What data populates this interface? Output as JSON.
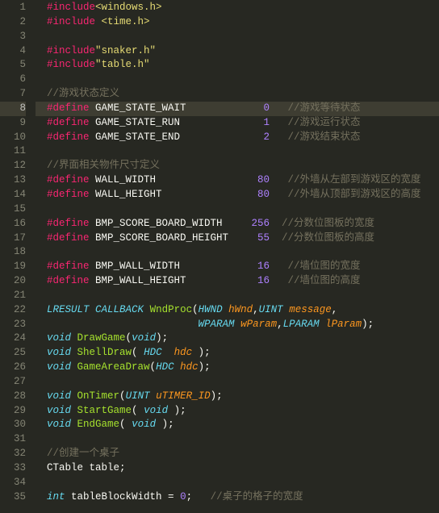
{
  "gutter": {
    "start": 1,
    "end": 35,
    "active": 8
  },
  "code": {
    "lines": [
      [
        {
          "c": "tok-preproc",
          "t": "#include"
        },
        {
          "c": "tok-string",
          "t": "<windows.h>"
        }
      ],
      [
        {
          "c": "tok-preproc",
          "t": "#include"
        },
        {
          "c": "tok-plain",
          "t": " "
        },
        {
          "c": "tok-string",
          "t": "<time.h>"
        }
      ],
      [],
      [
        {
          "c": "tok-preproc",
          "t": "#include"
        },
        {
          "c": "tok-string",
          "t": "\"snaker.h\""
        }
      ],
      [
        {
          "c": "tok-preproc",
          "t": "#include"
        },
        {
          "c": "tok-string",
          "t": "\"table.h\""
        }
      ],
      [],
      [
        {
          "c": "tok-comment",
          "t": "//游戏状态定义"
        }
      ],
      [
        {
          "c": "tok-preproc",
          "t": "#define"
        },
        {
          "c": "tok-plain",
          "t": " "
        },
        {
          "c": "tok-ident col1",
          "t": "GAME_STATE_WAIT"
        },
        {
          "c": "tok-number col2",
          "t": "0"
        },
        {
          "c": "tok-plain",
          "t": "   "
        },
        {
          "c": "tok-comment",
          "t": "//游戏等待状态"
        }
      ],
      [
        {
          "c": "tok-preproc",
          "t": "#define"
        },
        {
          "c": "tok-plain",
          "t": " "
        },
        {
          "c": "tok-ident col1",
          "t": "GAME_STATE_RUN"
        },
        {
          "c": "tok-number col2",
          "t": "1"
        },
        {
          "c": "tok-plain",
          "t": "   "
        },
        {
          "c": "tok-comment",
          "t": "//游戏运行状态"
        }
      ],
      [
        {
          "c": "tok-preproc",
          "t": "#define"
        },
        {
          "c": "tok-plain",
          "t": " "
        },
        {
          "c": "tok-ident col1",
          "t": "GAME_STATE_END"
        },
        {
          "c": "tok-number col2",
          "t": "2"
        },
        {
          "c": "tok-plain",
          "t": "   "
        },
        {
          "c": "tok-comment",
          "t": "//游戏结束状态"
        }
      ],
      [],
      [
        {
          "c": "tok-comment",
          "t": "//界面相关物件尺寸定义"
        }
      ],
      [
        {
          "c": "tok-preproc",
          "t": "#define"
        },
        {
          "c": "tok-plain",
          "t": " "
        },
        {
          "c": "tok-ident col1",
          "t": "WALL_WIDTH"
        },
        {
          "c": "tok-number col2",
          "t": "80"
        },
        {
          "c": "tok-plain",
          "t": "   "
        },
        {
          "c": "tok-comment",
          "t": "//外墙从左部到游戏区的宽度"
        }
      ],
      [
        {
          "c": "tok-preproc",
          "t": "#define"
        },
        {
          "c": "tok-plain",
          "t": " "
        },
        {
          "c": "tok-ident col1",
          "t": "WALL_HEIGHT"
        },
        {
          "c": "tok-number col2",
          "t": "80"
        },
        {
          "c": "tok-plain",
          "t": "   "
        },
        {
          "c": "tok-comment",
          "t": "//外墙从顶部到游戏区的高度"
        }
      ],
      [],
      [
        {
          "c": "tok-preproc",
          "t": "#define"
        },
        {
          "c": "tok-plain",
          "t": " "
        },
        {
          "c": "tok-ident col1",
          "t": "BMP_SCORE_BOARD_WIDTH"
        },
        {
          "c": "tok-number col2",
          "t": "256"
        },
        {
          "c": "tok-plain",
          "t": "  "
        },
        {
          "c": "tok-comment",
          "t": "//分数位图板的宽度"
        }
      ],
      [
        {
          "c": "tok-preproc",
          "t": "#define"
        },
        {
          "c": "tok-plain",
          "t": " "
        },
        {
          "c": "tok-ident col1",
          "t": "BMP_SCORE_BOARD_HEIGHT"
        },
        {
          "c": "tok-number col2",
          "t": "55"
        },
        {
          "c": "tok-plain",
          "t": "  "
        },
        {
          "c": "tok-comment",
          "t": "//分数位图板的高度"
        }
      ],
      [],
      [
        {
          "c": "tok-preproc",
          "t": "#define"
        },
        {
          "c": "tok-plain",
          "t": " "
        },
        {
          "c": "tok-ident col1",
          "t": "BMP_WALL_WIDTH"
        },
        {
          "c": "tok-number col2",
          "t": "16"
        },
        {
          "c": "tok-plain",
          "t": "   "
        },
        {
          "c": "tok-comment",
          "t": "//墙位图的宽度"
        }
      ],
      [
        {
          "c": "tok-preproc",
          "t": "#define"
        },
        {
          "c": "tok-plain",
          "t": " "
        },
        {
          "c": "tok-ident col1",
          "t": "BMP_WALL_HEIGHT"
        },
        {
          "c": "tok-number col2",
          "t": "16"
        },
        {
          "c": "tok-plain",
          "t": "   "
        },
        {
          "c": "tok-comment",
          "t": "//墙位图的高度"
        }
      ],
      [],
      [
        {
          "c": "tok-type",
          "t": "LRESULT"
        },
        {
          "c": "tok-plain",
          "t": " "
        },
        {
          "c": "tok-type",
          "t": "CALLBACK"
        },
        {
          "c": "tok-plain",
          "t": " "
        },
        {
          "c": "tok-func",
          "t": "WndProc"
        },
        {
          "c": "tok-plain",
          "t": "("
        },
        {
          "c": "tok-type",
          "t": "HWND"
        },
        {
          "c": "tok-plain",
          "t": " "
        },
        {
          "c": "tok-param",
          "t": "hWnd"
        },
        {
          "c": "tok-plain",
          "t": ","
        },
        {
          "c": "tok-type",
          "t": "UINT"
        },
        {
          "c": "tok-plain",
          "t": " "
        },
        {
          "c": "tok-param",
          "t": "message"
        },
        {
          "c": "tok-plain",
          "t": ","
        }
      ],
      [
        {
          "c": "tok-plain",
          "t": "                         "
        },
        {
          "c": "tok-type",
          "t": "WPARAM"
        },
        {
          "c": "tok-plain",
          "t": " "
        },
        {
          "c": "tok-param",
          "t": "wParam"
        },
        {
          "c": "tok-plain",
          "t": ","
        },
        {
          "c": "tok-type",
          "t": "LPARAM"
        },
        {
          "c": "tok-plain",
          "t": " "
        },
        {
          "c": "tok-param",
          "t": "lParam"
        },
        {
          "c": "tok-plain",
          "t": ");"
        }
      ],
      [
        {
          "c": "tok-type",
          "t": "void"
        },
        {
          "c": "tok-plain",
          "t": " "
        },
        {
          "c": "tok-func",
          "t": "DrawGame"
        },
        {
          "c": "tok-plain",
          "t": "("
        },
        {
          "c": "tok-type",
          "t": "void"
        },
        {
          "c": "tok-plain",
          "t": ");"
        }
      ],
      [
        {
          "c": "tok-type",
          "t": "void"
        },
        {
          "c": "tok-plain",
          "t": " "
        },
        {
          "c": "tok-func",
          "t": "ShellDraw"
        },
        {
          "c": "tok-plain",
          "t": "( "
        },
        {
          "c": "tok-type",
          "t": "HDC"
        },
        {
          "c": "tok-plain",
          "t": "  "
        },
        {
          "c": "tok-param",
          "t": "hdc"
        },
        {
          "c": "tok-plain",
          "t": " );"
        }
      ],
      [
        {
          "c": "tok-type",
          "t": "void"
        },
        {
          "c": "tok-plain",
          "t": " "
        },
        {
          "c": "tok-func",
          "t": "GameAreaDraw"
        },
        {
          "c": "tok-plain",
          "t": "("
        },
        {
          "c": "tok-type",
          "t": "HDC"
        },
        {
          "c": "tok-plain",
          "t": " "
        },
        {
          "c": "tok-param",
          "t": "hdc"
        },
        {
          "c": "tok-plain",
          "t": ");"
        }
      ],
      [],
      [
        {
          "c": "tok-type",
          "t": "void"
        },
        {
          "c": "tok-plain",
          "t": " "
        },
        {
          "c": "tok-func",
          "t": "OnTimer"
        },
        {
          "c": "tok-plain",
          "t": "("
        },
        {
          "c": "tok-type",
          "t": "UINT"
        },
        {
          "c": "tok-plain",
          "t": " "
        },
        {
          "c": "tok-param",
          "t": "uTIMER_ID"
        },
        {
          "c": "tok-plain",
          "t": ");"
        }
      ],
      [
        {
          "c": "tok-type",
          "t": "void"
        },
        {
          "c": "tok-plain",
          "t": " "
        },
        {
          "c": "tok-func",
          "t": "StartGame"
        },
        {
          "c": "tok-plain",
          "t": "( "
        },
        {
          "c": "tok-type",
          "t": "void"
        },
        {
          "c": "tok-plain",
          "t": " );"
        }
      ],
      [
        {
          "c": "tok-type",
          "t": "void"
        },
        {
          "c": "tok-plain",
          "t": " "
        },
        {
          "c": "tok-func",
          "t": "EndGame"
        },
        {
          "c": "tok-plain",
          "t": "( "
        },
        {
          "c": "tok-type",
          "t": "void"
        },
        {
          "c": "tok-plain",
          "t": " );"
        }
      ],
      [],
      [
        {
          "c": "tok-comment",
          "t": "//创建一个桌子"
        }
      ],
      [
        {
          "c": "tok-ident",
          "t": "CTable table;"
        }
      ],
      [],
      [
        {
          "c": "tok-type",
          "t": "int"
        },
        {
          "c": "tok-plain",
          "t": " "
        },
        {
          "c": "tok-ident",
          "t": "tableBlockWidth = "
        },
        {
          "c": "tok-number",
          "t": "0"
        },
        {
          "c": "tok-plain",
          "t": ";   "
        },
        {
          "c": "tok-comment",
          "t": "//桌子的格子的宽度"
        }
      ]
    ]
  }
}
